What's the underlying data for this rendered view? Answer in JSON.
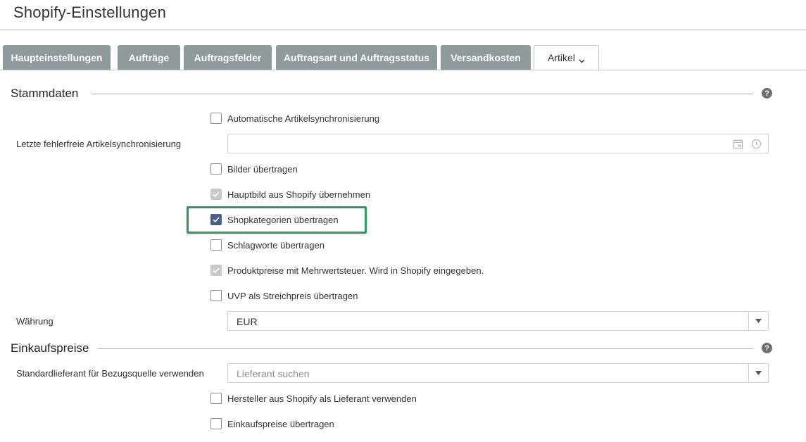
{
  "page": {
    "title": "Shopify-Einstellungen"
  },
  "tabs": [
    {
      "label": "Haupteinstellungen"
    },
    {
      "label": "Aufträge"
    },
    {
      "label": "Auftragsfelder"
    },
    {
      "label": "Auftragsart und Auftragsstatus"
    },
    {
      "label": "Versandkosten"
    },
    {
      "label": "Artikel",
      "active": true
    }
  ],
  "sections": {
    "stammdaten": {
      "title": "Stammdaten",
      "help": "?",
      "auto_sync": {
        "label": "Automatische Artikelsynchronisierung",
        "checked": false
      },
      "last_sync": {
        "label": "Letzte fehlerfreie Artikelsynchronisierung",
        "value": ""
      },
      "images": {
        "label": "Bilder übertragen",
        "checked": false
      },
      "main_image": {
        "label": "Hauptbild aus Shopify übernehmen",
        "checked": true,
        "disabled": true
      },
      "shop_categories": {
        "label": "Shopkategorien übertragen",
        "checked": true
      },
      "keywords": {
        "label": "Schlagworte übertragen",
        "checked": false
      },
      "prices_vat": {
        "label": "Produktpreise mit Mehrwertsteuer. Wird in Shopify eingegeben.",
        "checked": true,
        "disabled": true
      },
      "rrp": {
        "label": "UVP als Streichpreis übertragen",
        "checked": false
      },
      "currency": {
        "label": "Währung",
        "value": "EUR"
      }
    },
    "einkaufspreise": {
      "title": "Einkaufspreise",
      "help": "?",
      "default_supplier": {
        "label": "Standardlieferant für Bezugsquelle verwenden",
        "placeholder": "Lieferant suchen"
      },
      "manufacturer_supplier": {
        "label": "Hersteller aus Shopify als Lieferant verwenden",
        "checked": false
      },
      "purchase_prices": {
        "label": "Einkaufspreise übertragen",
        "checked": false
      }
    }
  },
  "colors": {
    "tab_bg": "#8e9a9b",
    "checkbox_checked": "#4a5f8c",
    "highlight": "#2e9a5f"
  }
}
